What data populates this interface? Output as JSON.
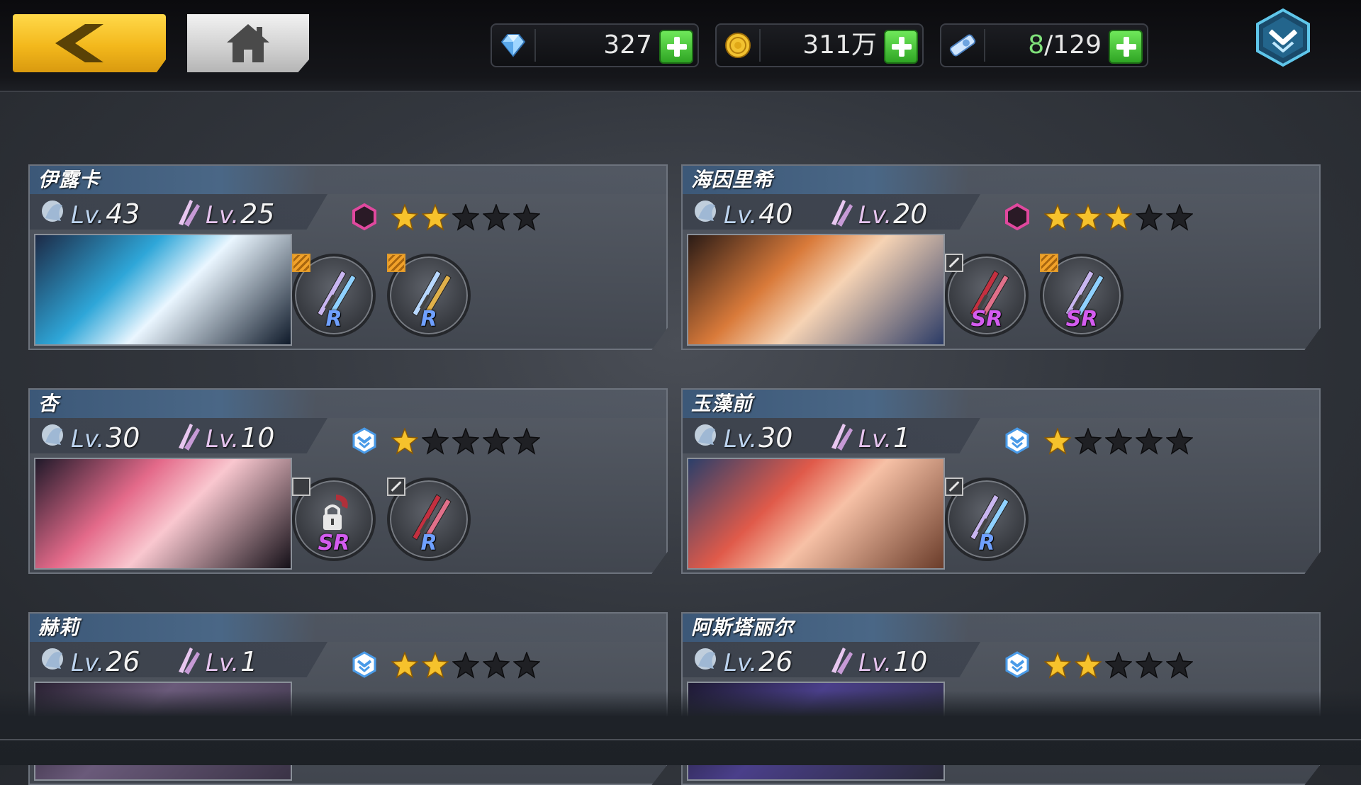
{
  "topbar": {
    "back_icon": "chevron-left-icon",
    "home_icon": "home-icon",
    "resources": [
      {
        "icon": "diamond-icon",
        "value": "327"
      },
      {
        "icon": "gold-coin-icon",
        "value": "311万"
      },
      {
        "icon": "ticket-icon",
        "current": "8",
        "max": "/129"
      }
    ],
    "menu_icon": "dropdown-chevron-icon"
  },
  "colors": {
    "back_button": "#f3b81c",
    "plus_button": "#3fbb30",
    "rank_pink": "#e0489e",
    "rank_blue": "#4a9be8",
    "star_gold": "#f6c22c",
    "rarity_R": "#6fa0ff",
    "rarity_SR": "#d45cf0"
  },
  "cards": [
    {
      "name": "伊露卡",
      "lv1_tag": "Lv.",
      "lv1": "43",
      "lv2_tag": "Lv.",
      "lv2": "25",
      "rank": "pink-hexagon",
      "stars": 2,
      "weapons": [
        {
          "rarity": "R",
          "tag": "gold"
        },
        {
          "rarity": "R",
          "tag": "gold"
        }
      ]
    },
    {
      "name": "海因里希",
      "lv1_tag": "Lv.",
      "lv1": "40",
      "lv2_tag": "Lv.",
      "lv2": "20",
      "rank": "pink-hexagon",
      "stars": 3,
      "weapons": [
        {
          "rarity": "SR",
          "tag": "grey"
        },
        {
          "rarity": "SR",
          "tag": "gold"
        }
      ]
    },
    {
      "name": "杏",
      "lv1_tag": "Lv.",
      "lv1": "30",
      "lv2_tag": "Lv.",
      "lv2": "10",
      "rank": "blue-chevron",
      "stars": 1,
      "weapons": [
        {
          "rarity": "SR",
          "tag": "dark",
          "locked": true
        },
        {
          "rarity": "R",
          "tag": "grey"
        }
      ]
    },
    {
      "name": "玉藻前",
      "lv1_tag": "Lv.",
      "lv1": "30",
      "lv2_tag": "Lv.",
      "lv2": "1",
      "rank": "blue-chevron",
      "stars": 1,
      "weapons": [
        {
          "rarity": "R",
          "tag": "grey"
        }
      ]
    },
    {
      "name": "赫莉",
      "lv1_tag": "Lv.",
      "lv1": "26",
      "lv2_tag": "Lv.",
      "lv2": "1",
      "rank": "blue-chevron",
      "stars": 2,
      "weapons": []
    },
    {
      "name": "阿斯塔丽尔",
      "lv1_tag": "Lv.",
      "lv1": "26",
      "lv2_tag": "Lv.",
      "lv2": "10",
      "rank": "blue-chevron",
      "stars": 2,
      "weapons": []
    }
  ]
}
